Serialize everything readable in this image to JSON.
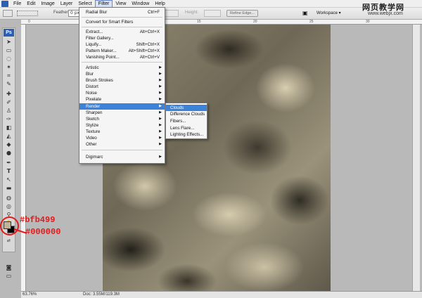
{
  "menubar": {
    "items": [
      {
        "label": "File",
        "active": false
      },
      {
        "label": "Edit",
        "active": false
      },
      {
        "label": "Image",
        "active": false
      },
      {
        "label": "Layer",
        "active": false
      },
      {
        "label": "Select",
        "active": false
      },
      {
        "label": "Filter",
        "active": true
      },
      {
        "label": "View",
        "active": false
      },
      {
        "label": "Window",
        "active": false
      },
      {
        "label": "Help",
        "active": false
      }
    ]
  },
  "options": {
    "feather_label": "Feather:",
    "feather_value": "0 px",
    "height_label": "Height:",
    "refine_edge": "Refine Edge...",
    "workspace": "Workspace ▾"
  },
  "watermark": {
    "title": "网页教学网",
    "url": "www.webjx.com"
  },
  "toolbox": {
    "badge": "Ps",
    "foreground_color": "#bfb499",
    "background_color": "#000000"
  },
  "annotations": {
    "foreground_hex": "#bfb499",
    "background_hex": "#000000"
  },
  "status": {
    "zoom": "63.76%",
    "doc": "Doc: 3.55M/119.3M"
  },
  "filter_menu": {
    "items": [
      {
        "label": "Radial Blur",
        "shortcut": "Ctrl+F",
        "submenu": false
      },
      {
        "label": "Convert for Smart Filters",
        "shortcut": "",
        "submenu": false
      },
      {
        "label": "Extract...",
        "shortcut": "Alt+Ctrl+X",
        "submenu": false
      },
      {
        "label": "Filter Gallery...",
        "shortcut": "",
        "submenu": false
      },
      {
        "label": "Liquify...",
        "shortcut": "Shift+Ctrl+X",
        "submenu": false
      },
      {
        "label": "Pattern Maker...",
        "shortcut": "Alt+Shift+Ctrl+X",
        "submenu": false
      },
      {
        "label": "Vanishing Point...",
        "shortcut": "Alt+Ctrl+V",
        "submenu": false
      },
      {
        "label": "Artistic",
        "shortcut": "",
        "submenu": true
      },
      {
        "label": "Blur",
        "shortcut": "",
        "submenu": true
      },
      {
        "label": "Brush Strokes",
        "shortcut": "",
        "submenu": true
      },
      {
        "label": "Distort",
        "shortcut": "",
        "submenu": true
      },
      {
        "label": "Noise",
        "shortcut": "",
        "submenu": true
      },
      {
        "label": "Pixelate",
        "shortcut": "",
        "submenu": true
      },
      {
        "label": "Render",
        "shortcut": "",
        "submenu": true
      },
      {
        "label": "Sharpen",
        "shortcut": "",
        "submenu": true
      },
      {
        "label": "Sketch",
        "shortcut": "",
        "submenu": true
      },
      {
        "label": "Stylize",
        "shortcut": "",
        "submenu": true
      },
      {
        "label": "Texture",
        "shortcut": "",
        "submenu": true
      },
      {
        "label": "Video",
        "shortcut": "",
        "submenu": true
      },
      {
        "label": "Other",
        "shortcut": "",
        "submenu": true
      },
      {
        "label": "Digimarc",
        "shortcut": "",
        "submenu": true
      }
    ]
  },
  "render_menu": {
    "items": [
      "Clouds",
      "Difference Clouds",
      "Fibers...",
      "Lens Flare...",
      "Lighting Effects..."
    ]
  },
  "ruler": {
    "ticks": [
      "0",
      "5",
      "10",
      "15",
      "20",
      "25",
      "30"
    ]
  }
}
